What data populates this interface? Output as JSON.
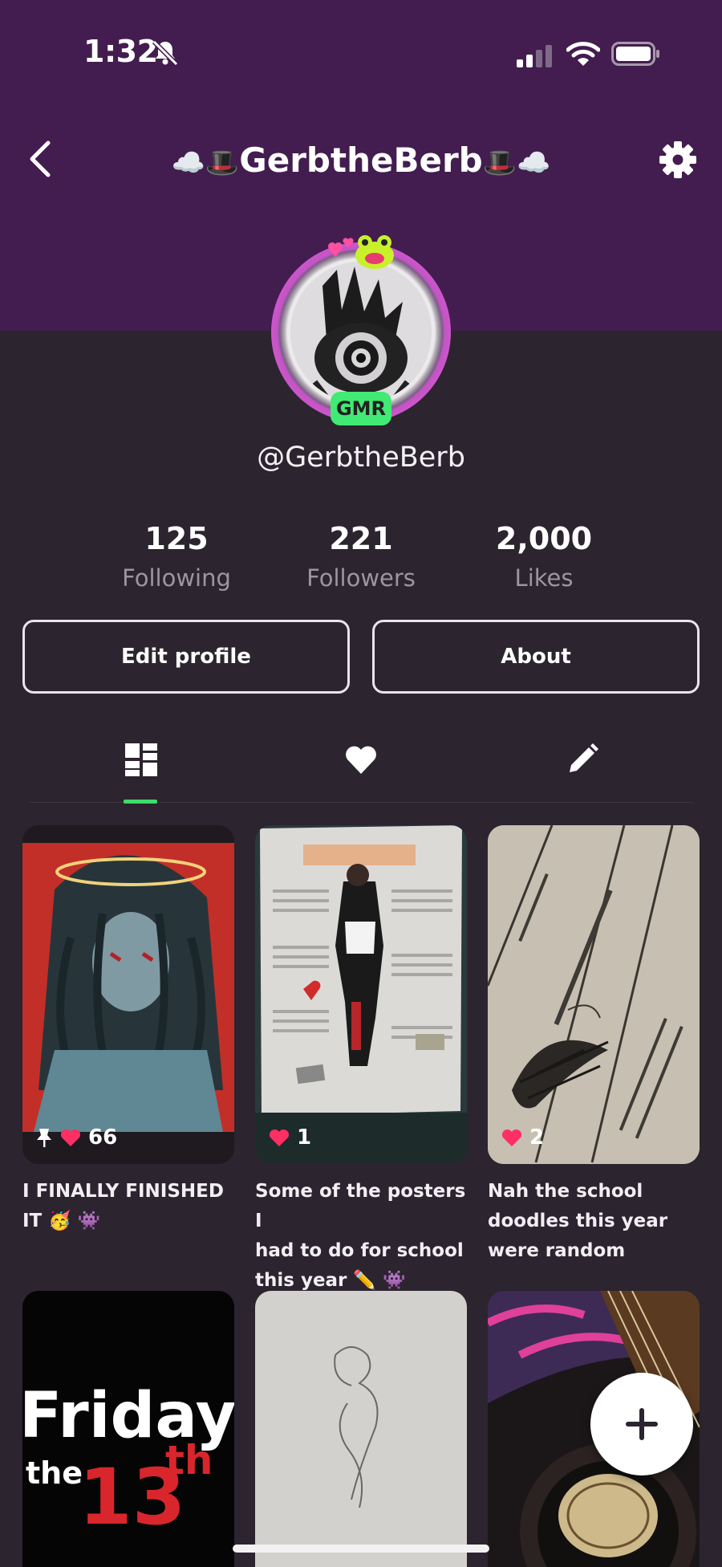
{
  "status_bar": {
    "time": "1:32"
  },
  "header": {
    "title_emoji_left": "☁️🎩",
    "title_text": "GerbtheBerb",
    "title_emoji_right": "🎩☁️"
  },
  "profile": {
    "badge": "GMR",
    "handle": "@GerbtheBerb"
  },
  "stats": [
    {
      "value": "125",
      "label": "Following"
    },
    {
      "value": "221",
      "label": "Followers"
    },
    {
      "value": "2,000",
      "label": "Likes"
    }
  ],
  "buttons": {
    "edit_profile": "Edit profile",
    "about": "About"
  },
  "posts": [
    {
      "likes": "66",
      "pinned": true,
      "caption_line1": "I FINALLY FINISHED",
      "caption_line2": "IT 🥳 👾"
    },
    {
      "likes": "1",
      "caption_line1": "Some of the posters I",
      "caption_line2": "had to do for school",
      "caption_line3": "this year ✏️ 👾"
    },
    {
      "likes": "2",
      "caption_line1": "Nah the school",
      "caption_line2": "doodles this year",
      "caption_line3": "were random"
    }
  ],
  "thumb_text": {
    "friday": "Friday",
    "the": "the",
    "thirteen": "13",
    "th": "th"
  },
  "colors": {
    "header_bg": "#431d4f",
    "page_bg": "#2c242f",
    "accent_green": "#3ddc6b",
    "like_red": "#ff2e63"
  }
}
